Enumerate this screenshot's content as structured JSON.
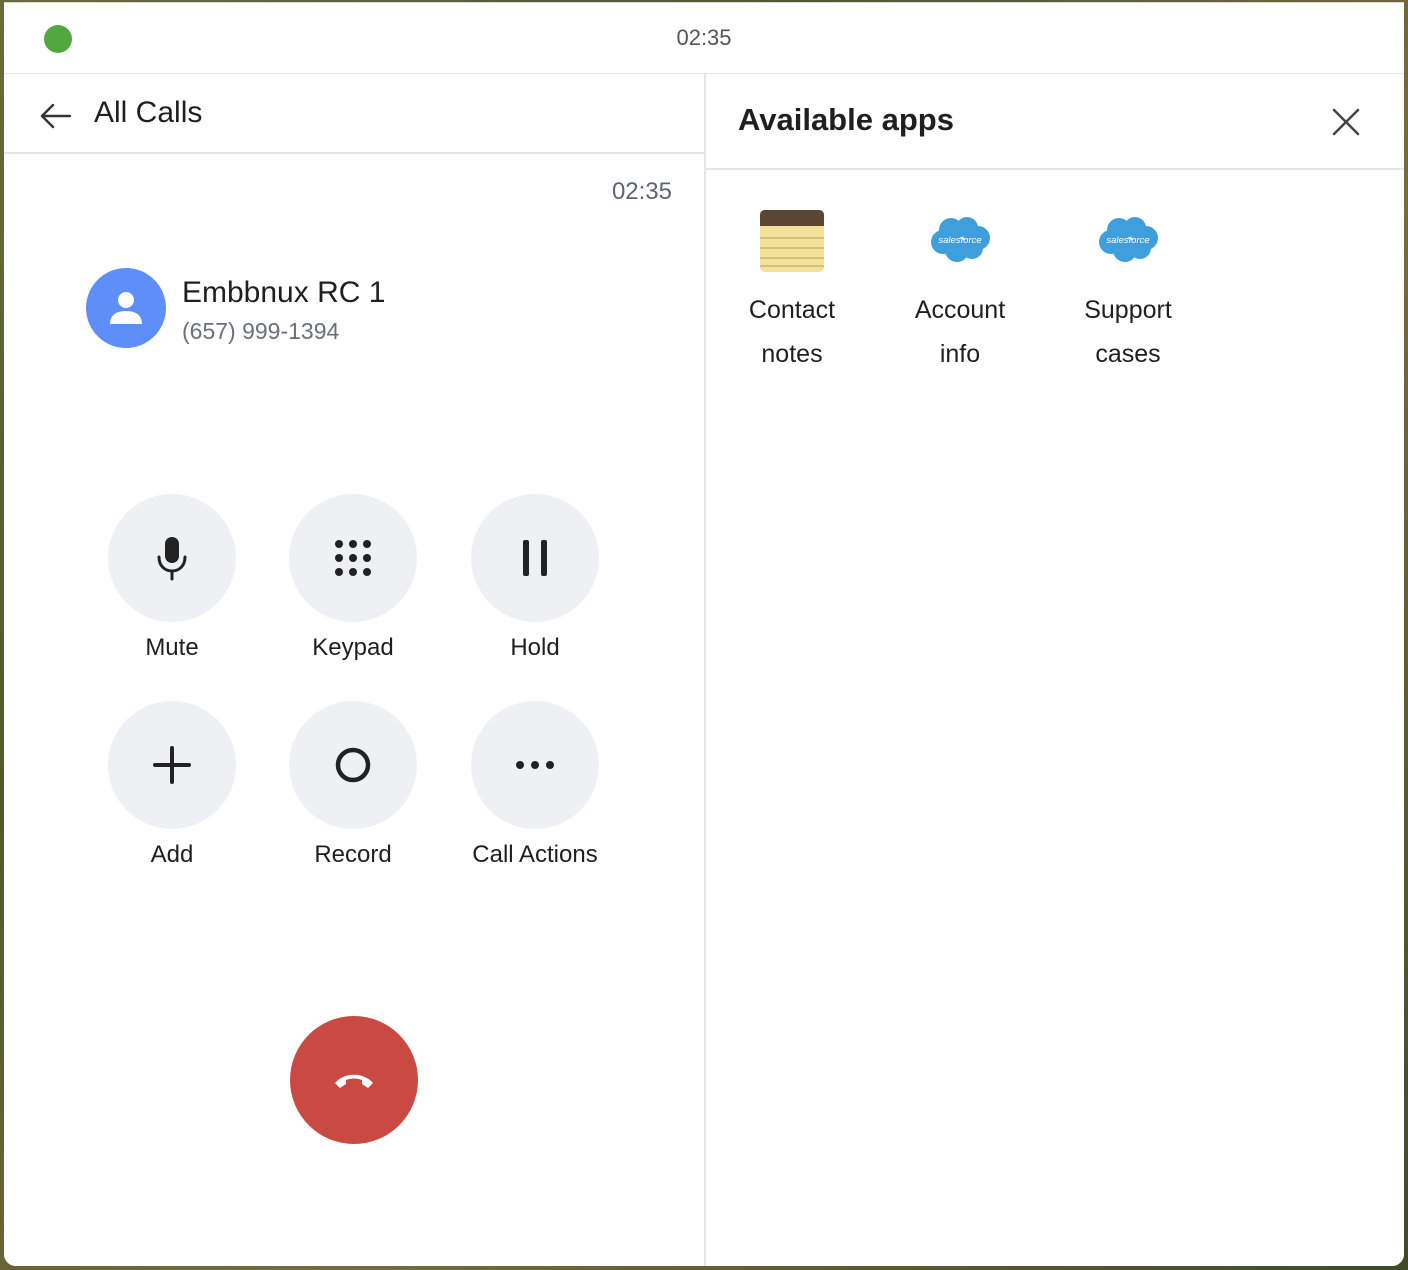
{
  "titlebar": {
    "time": "02:35",
    "status_color": "#52a83e"
  },
  "left": {
    "back_label": "All Calls",
    "timer": "02:35",
    "contact": {
      "name": "Embbnux RC 1",
      "phone": "(657) 999-1394"
    },
    "controls": [
      {
        "label": "Mute",
        "icon": "microphone-icon"
      },
      {
        "label": "Keypad",
        "icon": "keypad-icon"
      },
      {
        "label": "Hold",
        "icon": "pause-icon"
      },
      {
        "label": "Add",
        "icon": "plus-icon"
      },
      {
        "label": "Record",
        "icon": "record-icon"
      },
      {
        "label": "Call Actions",
        "icon": "more-icon"
      }
    ],
    "hangup_icon": "hangup-icon",
    "hangup_color": "#c94a43"
  },
  "right": {
    "title": "Available apps",
    "apps": [
      {
        "line1": "Contact",
        "line2": "notes",
        "icon": "notepad-icon"
      },
      {
        "line1": "Account",
        "line2": "info",
        "icon": "salesforce-icon",
        "logo_text": "salesforce"
      },
      {
        "line1": "Support",
        "line2": "cases",
        "icon": "salesforce-icon",
        "logo_text": "salesforce"
      }
    ]
  }
}
